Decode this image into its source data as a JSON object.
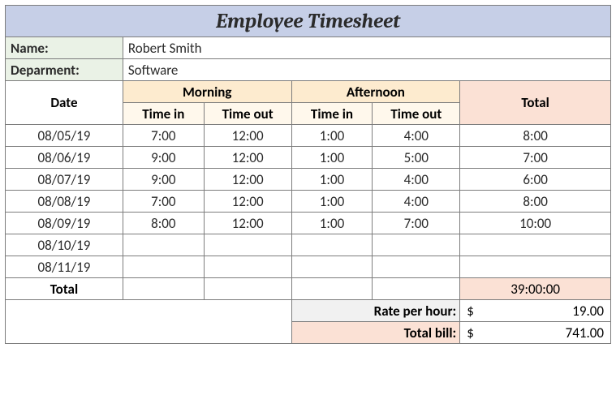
{
  "title": "Employee Timesheet",
  "name_label": "Name:",
  "name_value": "Robert Smith",
  "dept_label": "Deparment:",
  "dept_value": "Software",
  "headers": {
    "date": "Date",
    "morning": "Morning",
    "afternoon": "Afternoon",
    "total": "Total",
    "time_in": "Time in",
    "time_out": "Time out"
  },
  "rows": [
    {
      "date": "08/05/19",
      "m_in": "7:00",
      "m_out": "12:00",
      "a_in": "1:00",
      "a_out": "4:00",
      "total": "8:00"
    },
    {
      "date": "08/06/19",
      "m_in": "9:00",
      "m_out": "12:00",
      "a_in": "1:00",
      "a_out": "5:00",
      "total": "7:00"
    },
    {
      "date": "08/07/19",
      "m_in": "9:00",
      "m_out": "12:00",
      "a_in": "1:00",
      "a_out": "4:00",
      "total": "6:00"
    },
    {
      "date": "08/08/19",
      "m_in": "7:00",
      "m_out": "12:00",
      "a_in": "1:00",
      "a_out": "4:00",
      "total": "8:00"
    },
    {
      "date": "08/09/19",
      "m_in": "8:00",
      "m_out": "12:00",
      "a_in": "1:00",
      "a_out": "7:00",
      "total": "10:00"
    },
    {
      "date": "08/10/19",
      "m_in": "",
      "m_out": "",
      "a_in": "",
      "a_out": "",
      "total": ""
    },
    {
      "date": "08/11/19",
      "m_in": "",
      "m_out": "",
      "a_in": "",
      "a_out": "",
      "total": ""
    }
  ],
  "total_label": "Total",
  "total_hours": "39:00:00",
  "rate_label": "Rate per hour:",
  "rate_currency": "$",
  "rate_value": "19.00",
  "bill_label": "Total bill:",
  "bill_currency": "$",
  "bill_value": "741.00",
  "chart_data": {
    "type": "table",
    "title": "Employee Timesheet",
    "columns": [
      "Date",
      "Morning Time in",
      "Morning Time out",
      "Afternoon Time in",
      "Afternoon Time out",
      "Total"
    ],
    "rows": [
      [
        "08/05/19",
        "7:00",
        "12:00",
        "1:00",
        "4:00",
        "8:00"
      ],
      [
        "08/06/19",
        "9:00",
        "12:00",
        "1:00",
        "5:00",
        "7:00"
      ],
      [
        "08/07/19",
        "9:00",
        "12:00",
        "1:00",
        "4:00",
        "6:00"
      ],
      [
        "08/08/19",
        "7:00",
        "12:00",
        "1:00",
        "4:00",
        "8:00"
      ],
      [
        "08/09/19",
        "8:00",
        "12:00",
        "1:00",
        "7:00",
        "10:00"
      ],
      [
        "08/10/19",
        "",
        "",
        "",
        "",
        ""
      ],
      [
        "08/11/19",
        "",
        "",
        "",
        "",
        ""
      ]
    ],
    "summary": {
      "total_hours": "39:00:00",
      "rate_per_hour": 19.0,
      "total_bill": 741.0
    }
  }
}
